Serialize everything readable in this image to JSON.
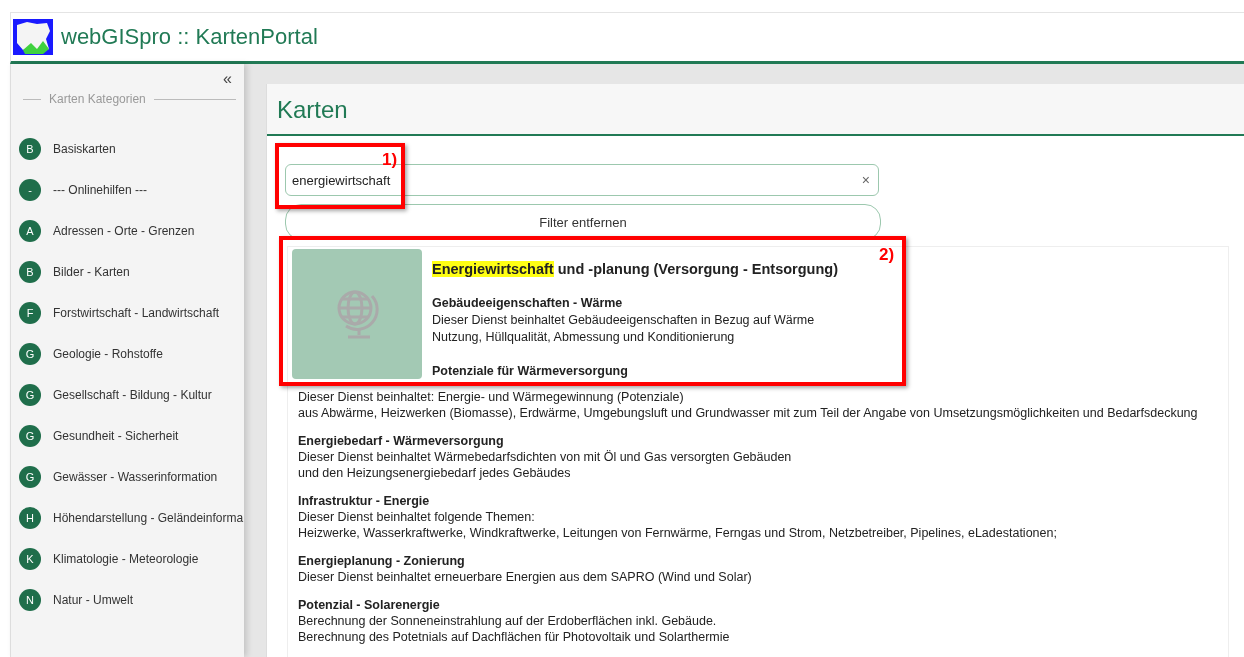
{
  "app": {
    "title": "webGISpro :: KartenPortal"
  },
  "sidebar": {
    "collapse": "«",
    "heading": "Karten Kategorien",
    "items": [
      {
        "badge": "B",
        "label": "Basiskarten"
      },
      {
        "badge": "-",
        "label": "--- Onlinehilfen ---"
      },
      {
        "badge": "A",
        "label": "Adressen - Orte - Grenzen"
      },
      {
        "badge": "B",
        "label": "Bilder - Karten"
      },
      {
        "badge": "F",
        "label": "Forstwirtschaft - Landwirtschaft"
      },
      {
        "badge": "G",
        "label": "Geologie - Rohstoffe"
      },
      {
        "badge": "G",
        "label": "Gesellschaft - Bildung - Kultur"
      },
      {
        "badge": "G",
        "label": "Gesundheit - Sicherheit"
      },
      {
        "badge": "G",
        "label": "Gewässer - Wasserinformation"
      },
      {
        "badge": "H",
        "label": "Höhendarstellung - Geländeinforma"
      },
      {
        "badge": "K",
        "label": "Klimatologie - Meteorologie"
      },
      {
        "badge": "N",
        "label": "Natur - Umwelt"
      }
    ]
  },
  "main": {
    "heading": "Karten",
    "search": {
      "value": "energiewirtschaft",
      "clear": "×"
    },
    "filter_button": "Filter entfernen",
    "result": {
      "title_highlight": "Energiewirtschaft",
      "title_rest": " und -planung (Versorgung - Entsorgung)",
      "sections": [
        {
          "title": "Gebäudeeigenschaften - Wärme",
          "lines": [
            "Dieser Dienst beinhaltet Gebäudeeigenschaften in Bezug auf Wärme",
            "Nutzung, Hüllqualität, Abmessung und Konditionierung"
          ]
        },
        {
          "title": "Potenziale für Wärmeversorgung",
          "lines": [
            "Dieser Dienst beinhaltet: Energie- und Wärmegewinnung (Potenziale)",
            "aus Abwärme, Heizwerken (Biomasse), Erdwärme, Umgebungsluft und Grundwasser mit zum Teil der Angabe von Umsetzungsmöglichkeiten und Bedarfsdeckung"
          ]
        },
        {
          "title": "Energiebedarf - Wärmeversorgung",
          "lines": [
            "Dieser Dienst beinhaltet Wärmebedarfsdichten von mit Öl und Gas versorgten Gebäuden",
            "und den Heizungsenergiebedarf jedes Gebäudes"
          ]
        },
        {
          "title": "Infrastruktur - Energie",
          "lines": [
            "Dieser Dienst beinhaltet folgende Themen:",
            "Heizwerke, Wasserkraftwerke, Windkraftwerke, Leitungen von Fernwärme, Ferngas und Strom, Netzbetreiber, Pipelines, eLadestationen;"
          ]
        },
        {
          "title": "Energieplanung - Zonierung",
          "lines": [
            "Dieser Dienst beinhaltet erneuerbare Energien aus dem SAPRO (Wind und Solar)"
          ]
        },
        {
          "title": "Potenzial - Solarenergie",
          "lines": [
            "Berechnung der Sonneneinstrahlung auf der Erdoberflächen inkl. Gebäude.",
            "Berechnung des Potetnials auf Dachflächen für Photovoltaik und Solarthermie"
          ]
        }
      ]
    }
  },
  "annotations": [
    {
      "label": "1)"
    },
    {
      "label": "2)"
    }
  ]
}
